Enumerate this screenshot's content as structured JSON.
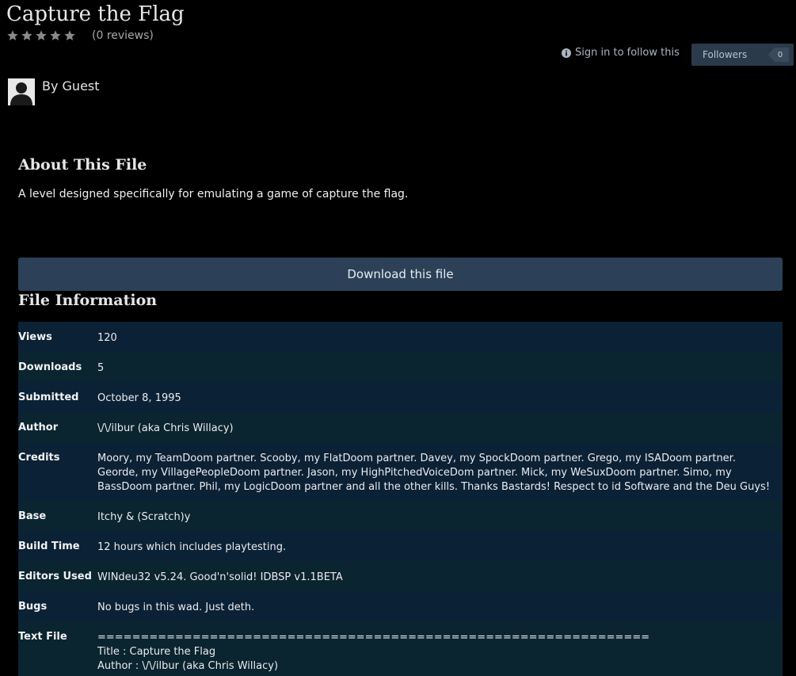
{
  "header": {
    "title": "Capture the Flag",
    "reviews": "(0 reviews)",
    "star_count": 5,
    "rating_value": 0,
    "follow_text": "Sign in to follow this",
    "followers_label": "Followers",
    "followers_count": "0"
  },
  "author": {
    "by_line": "By Guest"
  },
  "about": {
    "heading": "About This File",
    "text": "A level designed specifically for emulating a game of capture the flag."
  },
  "download": {
    "label": "Download this file"
  },
  "file_info": {
    "heading": "File Information",
    "rows": [
      {
        "label": "Views",
        "value": "120"
      },
      {
        "label": "Downloads",
        "value": "5"
      },
      {
        "label": "Submitted",
        "value": "October 8, 1995"
      },
      {
        "label": "Author",
        "value": "\\/\\/ilbur (aka Chris Willacy)"
      },
      {
        "label": "Credits",
        "value": "Moory, my TeamDoom partner. Scooby, my FlatDoom partner. Davey, my SpockDoom partner. Grego, my ISADoom partner. Georde, my VillagePeopleDoom partner. Jason, my HighPitchedVoiceDom partner. Mick, my WeSuxDoom partner. Simo, my BassDoom partner. Phil, my LogicDoom partner and all the other kills. Thanks Bastards! Respect to id Software and the Deu Guys!"
      },
      {
        "label": "Base",
        "value": "Itchy & (Scratch)y"
      },
      {
        "label": "Build Time",
        "value": "12 hours which includes playtesting."
      },
      {
        "label": "Editors Used",
        "value": "WINdeu32 v5.24. Good'n'solid! IDBSP v1.1BETA"
      },
      {
        "label": "Bugs",
        "value": "No bugs in this wad. Just deth."
      }
    ],
    "text_file": {
      "label": "Text File",
      "lines": [
        "================================================================",
        "Title : Capture the Flag",
        "Author : \\/\\/ilbur (aka Chris Willacy)"
      ]
    }
  },
  "colors": {
    "background": "#000000",
    "button": "#2c4157",
    "row_a": "#0b2136",
    "row_b": "#0a2430",
    "star": "#8a8a8a"
  }
}
